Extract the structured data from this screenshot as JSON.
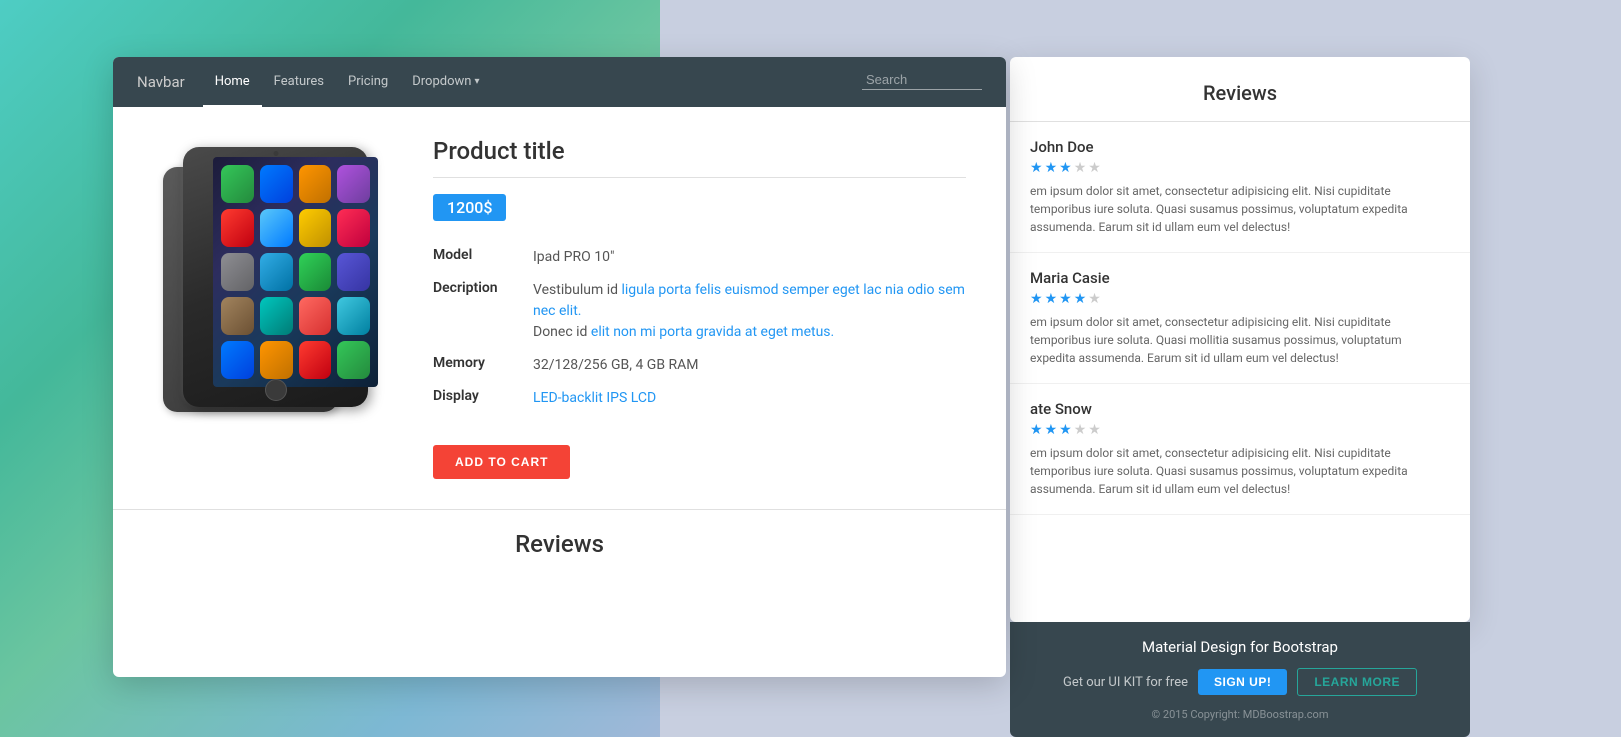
{
  "background": {
    "left_gradient": "linear-gradient teal to blue",
    "right_color": "#c8cfe0"
  },
  "navbar": {
    "brand": "Navbar",
    "links": [
      {
        "label": "Home",
        "active": true
      },
      {
        "label": "Features",
        "active": false
      },
      {
        "label": "Pricing",
        "active": false
      },
      {
        "label": "Dropdown",
        "active": false,
        "has_dropdown": true
      }
    ],
    "search_placeholder": "Search"
  },
  "product": {
    "title": "Product title",
    "price": "1200$",
    "specs": [
      {
        "label": "Model",
        "value": "Ipad PRO 10\""
      },
      {
        "label": "Decription",
        "value_parts": [
          {
            "text": "Vestibulum id ligula porta felis euismod semper eget lac nia odio sem nec elit.",
            "has_link": true
          },
          {
            "text": "Donec id elit non mi porta gravida at eget metus.",
            "has_link": true
          }
        ]
      },
      {
        "label": "Memory",
        "value": "32/128/256 GB, 4 GB RAM"
      },
      {
        "label": "Display",
        "value": "LED-backlit IPS LCD",
        "is_link": true
      }
    ],
    "add_to_cart_label": "ADD TO CART"
  },
  "reviews_section": {
    "title": "Reviews"
  },
  "right_panel": {
    "reviews_title": "Reviews",
    "reviews": [
      {
        "name": "John Doe",
        "stars": 3,
        "max_stars": 5,
        "text": "em ipsum dolor sit amet, consectetur adipisicing elit. Nisi cupiditate temporibus iure soluta. Quasi susamus possimus, voluptatum expedita assumenda. Earum sit id ullam eum vel delectus!"
      },
      {
        "name": "Maria Casie",
        "stars": 4,
        "max_stars": 5,
        "text": "em ipsum dolor sit amet, consectetur adipisicing elit. Nisi cupiditate temporibus iure soluta. Quasi mollitia susamus possimus, voluptatum expedita assumenda. Earum sit id ullam eum vel delectus!"
      },
      {
        "name": "ate Snow",
        "stars": 3,
        "max_stars": 5,
        "text": "em ipsum dolor sit amet, consectetur adipisicing elit. Nisi cupiditate temporibus iure soluta. Quasi susamus possimus, voluptatum expedita assumenda. Earum sit id ullam eum vel delectus!"
      }
    ],
    "footer": {
      "title": "Material Design for Bootstrap",
      "cta_text": "Get our UI KIT for free",
      "signup_label": "SIGN UP!",
      "learn_label": "LEARN MORE",
      "copyright": "© 2015 Copyright: MDBoostrap.com"
    }
  }
}
